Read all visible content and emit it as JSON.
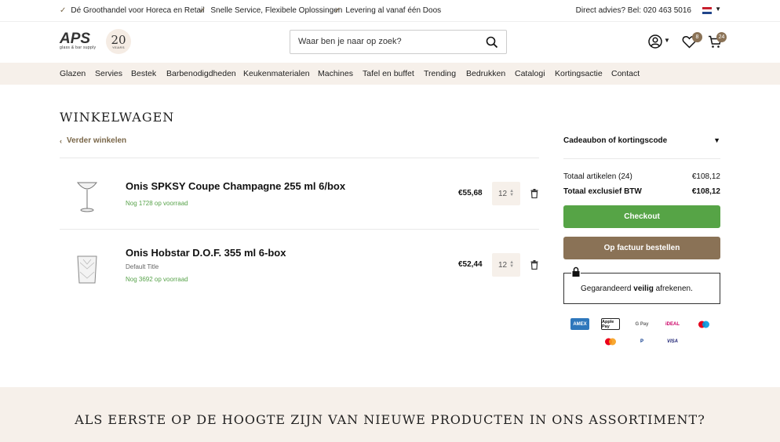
{
  "usp": [
    "Dé Groothandel voor Horeca en Retail",
    "Snelle Service, Flexibele Oplossingen",
    "Levering al vanaf één Doos"
  ],
  "advice": "Direct advies? Bel: 020 463 5016",
  "logo": {
    "text": "APS",
    "sub": "glass & bar supply",
    "badge_num": "20",
    "badge_sub": "YEARS"
  },
  "search": {
    "placeholder": "Waar ben je naar op zoek?"
  },
  "header": {
    "wishlist_count": "8",
    "cart_count": "24"
  },
  "nav": [
    "Glazen",
    "Servies",
    "Bestek",
    "Barbenodigdheden",
    "Keukenmaterialen",
    "Machines",
    "Tafel en buffet",
    "Trending",
    "Bedrukken",
    "Catalogi",
    "Kortingsactie",
    "Contact"
  ],
  "cart": {
    "title": "WINKELWAGEN",
    "back": "Verder winkelen",
    "items": [
      {
        "title": "Onis SPKSY Coupe Champagne 255 ml 6/box",
        "variant": "",
        "stock": "Nog 1728 op voorraad",
        "price": "€55,68",
        "qty": "12"
      },
      {
        "title": "Onis Hobstar D.O.F. 355 ml 6-box",
        "variant": "Default Title",
        "stock": "Nog 3692 op voorraad",
        "price": "€52,44",
        "qty": "12"
      }
    ]
  },
  "summary": {
    "coupon": "Cadeaubon of kortingscode",
    "total_items_label": "Totaal artikelen (24)",
    "total_items_value": "€108,12",
    "total_ex_label": "Totaal exclusief BTW",
    "total_ex_value": "€108,12",
    "checkout": "Checkout",
    "invoice": "Op factuur bestellen",
    "secure_pre": "Gegarandeerd ",
    "secure_bold": "veilig",
    "secure_post": " afrekenen."
  },
  "payments": [
    "AMEX",
    "Apple Pay",
    "G Pay",
    "iDEAL",
    "Maestro",
    "Mastercard",
    "PayPal",
    "VISA"
  ],
  "newsletter": {
    "title": "ALS EERSTE OP DE HOOGTE ZIJN VAN NIEUWE PRODUCTEN IN ONS ASSORTIMENT?"
  },
  "colors": {
    "brand": "#8a7256",
    "green": "#56a446",
    "cream": "#f6f0ea"
  }
}
